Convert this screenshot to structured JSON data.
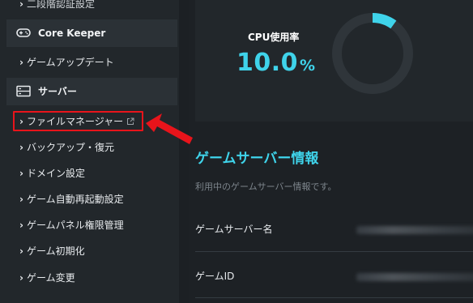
{
  "sidebar": {
    "top_item": "二段階認証設定",
    "sections": [
      {
        "label": "Core Keeper",
        "icon": "gamepad-icon"
      },
      {
        "label": "サーバー",
        "icon": "server-icon"
      }
    ],
    "core_keeper_items": [
      "ゲームアップデート"
    ],
    "server_items": [
      "ファイルマネージャー",
      "バックアップ・復元",
      "ドメイン設定",
      "ゲーム自動再起動設定",
      "ゲームパネル権限管理",
      "ゲーム初期化",
      "ゲーム変更"
    ]
  },
  "cpu": {
    "label": "CPU使用率",
    "value": "10.0",
    "unit": "%",
    "usage_fraction": 0.1
  },
  "server_info": {
    "title": "ゲームサーバー情報",
    "subtitle": "利用中のゲームサーバー情報です。",
    "rows": [
      {
        "label": "ゲームサーバー名"
      },
      {
        "label": "ゲームID"
      }
    ]
  },
  "colors": {
    "accent": "#3fd3ea",
    "highlight": "#e8141b",
    "sidebar_bg": "#22272b",
    "section_bg": "#2b3136"
  }
}
